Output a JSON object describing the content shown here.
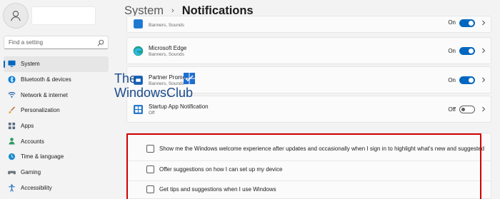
{
  "sidebar": {
    "search_placeholder": "Find a setting",
    "items": [
      {
        "label": "System",
        "icon": "monitor-icon",
        "active": true
      },
      {
        "label": "Bluetooth & devices",
        "icon": "bluetooth-icon"
      },
      {
        "label": "Network & internet",
        "icon": "wifi-icon"
      },
      {
        "label": "Personalization",
        "icon": "brush-icon"
      },
      {
        "label": "Apps",
        "icon": "apps-icon"
      },
      {
        "label": "Accounts",
        "icon": "person-icon"
      },
      {
        "label": "Time & language",
        "icon": "globe-clock-icon"
      },
      {
        "label": "Gaming",
        "icon": "gamepad-icon"
      },
      {
        "label": "Accessibility",
        "icon": "accessibility-icon"
      }
    ]
  },
  "header": {
    "parent": "System",
    "separator": "›",
    "current": "Notifications"
  },
  "apps": [
    {
      "title": "",
      "subtitle": "Banners, Sounds",
      "state": "On",
      "enabled": true,
      "icon": "app-icon-blue"
    },
    {
      "title": "Microsoft Edge",
      "subtitle": "Banners, Sounds",
      "state": "On",
      "enabled": true,
      "icon": "edge-icon"
    },
    {
      "title": "Partner Promo",
      "subtitle": "Banners, Sounds",
      "state": "On",
      "enabled": true,
      "icon": "partner-promo-icon"
    },
    {
      "title": "Startup App Notification",
      "subtitle": "Off",
      "state": "Off",
      "enabled": false,
      "icon": "startup-app-icon"
    }
  ],
  "watermark": {
    "line1": "The",
    "line2": "WindowsClub"
  },
  "suggestions": [
    {
      "label": "Show me the Windows welcome experience after updates and occasionally when I sign in to highlight what's new and suggested",
      "checked": false
    },
    {
      "label": "Offer suggestions on how I can set up my device",
      "checked": false
    },
    {
      "label": "Get tips and suggestions when I use Windows",
      "checked": false
    }
  ],
  "colors": {
    "accent": "#0067c0",
    "highlight_border": "#d10000"
  }
}
